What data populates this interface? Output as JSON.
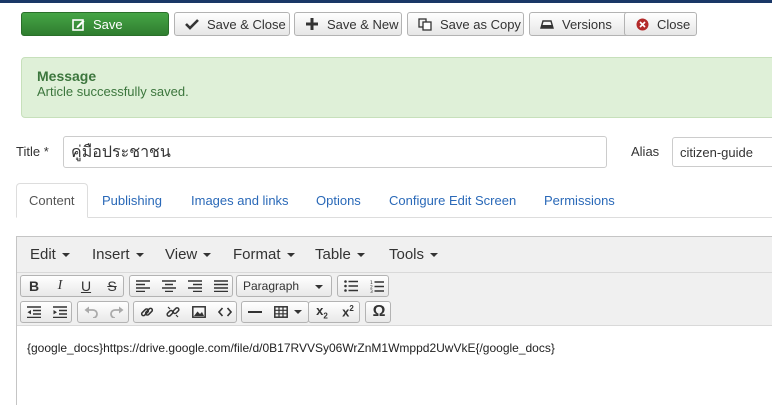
{
  "toolbar": {
    "save": "Save",
    "save_close": "Save & Close",
    "save_new": "Save & New",
    "save_copy": "Save as Copy",
    "versions": "Versions",
    "close": "Close"
  },
  "message": {
    "heading": "Message",
    "text": "Article successfully saved."
  },
  "form": {
    "title_label": "Title *",
    "title_value": "คู่มือประชาชน",
    "alias_label": "Alias",
    "alias_value": "citizen-guide"
  },
  "tabs": [
    "Content",
    "Publishing",
    "Images and links",
    "Options",
    "Configure Edit Screen",
    "Permissions"
  ],
  "editor": {
    "menus": [
      "Edit",
      "Insert",
      "View",
      "Format",
      "Table",
      "Tools"
    ],
    "format_select": "Paragraph",
    "content": "{google_docs}https://drive.google.com/file/d/0B17RVVSy06WrZnM1Wmppd2UwVkE{/google_docs}"
  },
  "colors": {
    "save_green": "#3d9a3d",
    "message_bg": "#dff0d8",
    "message_text": "#3c763d",
    "tab_link": "#2a69b8"
  }
}
